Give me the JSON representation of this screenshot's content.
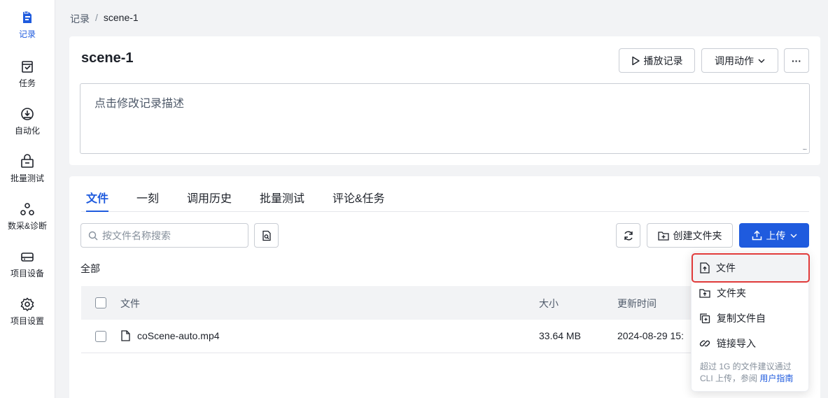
{
  "sidebar": {
    "items": [
      {
        "label": "记录",
        "icon": "record-icon",
        "active": true
      },
      {
        "label": "任务",
        "icon": "task-icon"
      },
      {
        "label": "自动化",
        "icon": "automation-icon"
      },
      {
        "label": "批量测试",
        "icon": "batch-test-icon"
      },
      {
        "label": "数采&诊断",
        "icon": "diagnosis-icon"
      },
      {
        "label": "项目设备",
        "icon": "device-icon"
      },
      {
        "label": "项目设置",
        "icon": "gear-icon"
      }
    ]
  },
  "breadcrumb": {
    "root": "记录",
    "separator": "/",
    "current": "scene-1"
  },
  "record": {
    "title": "scene-1",
    "play_label": "播放记录",
    "invoke_label": "调用动作",
    "more_label": "···",
    "description_placeholder": "点击修改记录描述",
    "resize_grip": "..."
  },
  "tabs": [
    {
      "label": "文件",
      "active": true
    },
    {
      "label": "一刻"
    },
    {
      "label": "调用历史"
    },
    {
      "label": "批量测试"
    },
    {
      "label": "评论&任务"
    }
  ],
  "toolbar": {
    "search_placeholder": "按文件名称搜索",
    "create_folder_label": "创建文件夹",
    "upload_label": "上传"
  },
  "files": {
    "scope_label": "全部",
    "columns": [
      "文件",
      "大小",
      "更新时间"
    ],
    "rows": [
      {
        "name": "coScene-auto.mp4",
        "size": "33.64 MB",
        "updated": "2024-08-29 15:"
      }
    ]
  },
  "upload_menu": {
    "items": [
      "文件",
      "文件夹",
      "复制文件自",
      "链接导入"
    ],
    "note": "超过 1G 的文件建议通过 CLI 上传，参阅",
    "note_link": "用户指南"
  },
  "colors": {
    "accent": "#1f5bde",
    "highlight": "#e03a3a"
  }
}
